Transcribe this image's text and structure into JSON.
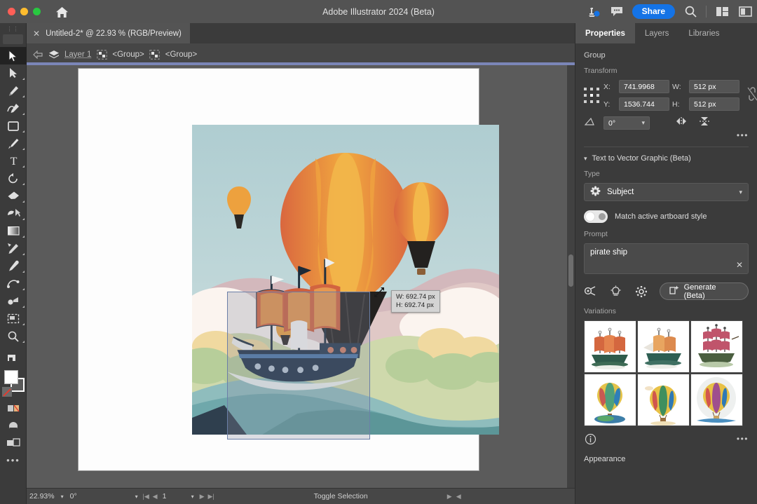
{
  "titlebar": {
    "app_title": "Adobe Illustrator 2024 (Beta)",
    "home_icon": "home-icon",
    "cloud_icon": "cloud-docs-icon",
    "comment_icon": "comment-icon",
    "share_label": "Share",
    "search_icon": "search-icon",
    "arrange_icon": "arrange-documents-icon",
    "workspace_icon": "workspace-switcher-icon",
    "accent_color": "#1473e6"
  },
  "document_tab": {
    "close_icon": "close-icon",
    "label": "Untitled-2* @ 22.93 % (RGB/Preview)"
  },
  "control_bar": {
    "back_icon": "navigate-back-icon",
    "layer_icon": "layers-icon",
    "crumbs": [
      {
        "label": "Layer 1",
        "icon": "layers-icon"
      },
      {
        "label": "<Group>",
        "icon": "group-icon"
      },
      {
        "label": "<Group>",
        "icon": "group-icon"
      }
    ]
  },
  "toolbar": {
    "tools": [
      {
        "name": "selection-tool",
        "active": true
      },
      {
        "name": "direct-selection-tool",
        "active": false
      },
      {
        "name": "pen-tool",
        "active": false
      },
      {
        "name": "curvature-tool",
        "active": false
      },
      {
        "name": "rectangle-tool",
        "active": false
      },
      {
        "name": "paintbrush-tool",
        "active": false
      },
      {
        "name": "type-tool",
        "active": false
      },
      {
        "name": "rotate-tool",
        "active": false
      },
      {
        "name": "eraser-tool",
        "active": false
      },
      {
        "name": "scale-tool",
        "active": false
      },
      {
        "name": "gradient-tool",
        "active": false
      },
      {
        "name": "width-tool",
        "active": false
      },
      {
        "name": "eyedropper-tool",
        "active": false
      },
      {
        "name": "blend-tool",
        "active": false
      },
      {
        "name": "symbol-sprayer-tool",
        "active": false
      },
      {
        "name": "artboard-tool",
        "active": false
      },
      {
        "name": "zoom-tool",
        "active": false
      }
    ],
    "more_tools_icon": "edit-toolbar-icon",
    "fill_color": "#ffffff",
    "stroke_color": "#5a5a5a"
  },
  "canvas": {
    "artboard_background": "#fdfdfd",
    "canvas_background": "#5b5b5b",
    "selection_tooltip": {
      "width_label": "W: 692.74 px",
      "height_label": "H: 692.74 px"
    }
  },
  "statusbar": {
    "zoom_value": "22.93%",
    "rotation_value": "0°",
    "artboard_number": "1",
    "status_text": "Toggle Selection",
    "nav_first_icon": "first-artboard-icon",
    "nav_prev_icon": "previous-artboard-icon",
    "nav_next_icon": "next-artboard-icon",
    "nav_last_icon": "last-artboard-icon"
  },
  "properties_panel": {
    "tabs": [
      {
        "label": "Properties",
        "active": true
      },
      {
        "label": "Layers",
        "active": false
      },
      {
        "label": "Libraries",
        "active": false
      }
    ],
    "object_type": "Group",
    "transform": {
      "section_label": "Transform",
      "reference_point_icon": "reference-point-grid",
      "x_label": "X:",
      "x_value": "741.9968",
      "y_label": "Y:",
      "y_value": "1536.744",
      "w_label": "W:",
      "w_value": "512 px",
      "h_label": "H:",
      "h_value": "512 px",
      "angle_icon": "shear-angle-icon",
      "angle_value": "0°",
      "link_icon": "constrain-proportions-icon",
      "flip_horizontal_icon": "flip-horizontal-icon",
      "flip_vertical_icon": "flip-vertical-icon",
      "more_options_icon": "more-options-icon"
    },
    "text_to_vector": {
      "section_title": "Text to Vector Graphic (Beta)",
      "chevron_icon": "chevron-down-icon",
      "type_label": "Type",
      "type_icon": "subject-icon",
      "type_value": "Subject",
      "type_caret_icon": "chevron-down-icon",
      "match_style_label": "Match active artboard style",
      "match_style_on": true,
      "prompt_label": "Prompt",
      "prompt_value": "pirate ship",
      "prompt_clear_icon": "clear-icon",
      "history_icon": "prompt-history-icon",
      "inspiration_icon": "lightbulb-icon",
      "settings_icon": "gear-icon",
      "generate_label": "Generate (Beta)",
      "generate_icon": "generate-icon"
    },
    "variations": {
      "section_label": "Variations",
      "items": [
        {
          "name": "variation-ship-1",
          "kind": "ship"
        },
        {
          "name": "variation-ship-2",
          "kind": "ship"
        },
        {
          "name": "variation-ship-3",
          "kind": "ship"
        },
        {
          "name": "variation-balloon-1",
          "kind": "balloon"
        },
        {
          "name": "variation-balloon-2",
          "kind": "balloon"
        },
        {
          "name": "variation-balloon-3",
          "kind": "balloon"
        }
      ],
      "info_icon": "info-icon",
      "more_icon": "more-options-icon"
    },
    "appearance_label": "Appearance"
  }
}
